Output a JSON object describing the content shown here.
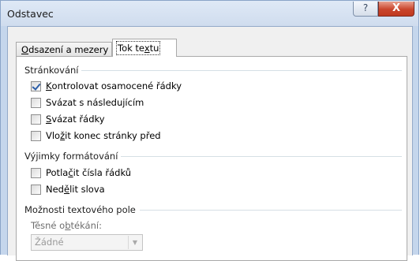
{
  "window": {
    "title": "Odstavec",
    "help_glyph": "?",
    "close_glyph": "X"
  },
  "tabs": [
    {
      "label_pre": "",
      "mnemonic": "O",
      "label_post": "dsazení a mezery",
      "active": false
    },
    {
      "label_pre": "Tok te",
      "mnemonic": "x",
      "label_post": "tu",
      "active": true
    }
  ],
  "pagination": {
    "heading": "Stránkování",
    "options": [
      {
        "pre": "",
        "mnemonic": "K",
        "post": "ontrolovat osamocené řádky",
        "checked": true
      },
      {
        "pre": "Svázat s následujícím",
        "mnemonic": "",
        "post": "",
        "checked": false
      },
      {
        "pre": "",
        "mnemonic": "S",
        "post": "vázat řádky",
        "checked": false
      },
      {
        "pre": "Vlo",
        "mnemonic": "ž",
        "post": "it konec stránky před",
        "checked": false
      }
    ]
  },
  "exceptions": {
    "heading": "Výjimky formátování",
    "options": [
      {
        "pre": "Potla",
        "mnemonic": "č",
        "post": "it čísla řádků",
        "checked": false
      },
      {
        "pre": "Ned",
        "mnemonic": "ě",
        "post": "lit slova",
        "checked": false
      }
    ]
  },
  "textbox": {
    "heading": "Možnosti textového pole",
    "wrap_label_pre": "Těsné o",
    "wrap_label_mnemonic": "b",
    "wrap_label_post": "tékání:",
    "wrap_value": "Žádné",
    "dropdown_glyph": "▼"
  },
  "colors": {
    "check_mark": "#2c5ea8",
    "close_button": "#c9452c",
    "title_bar": "#dfe9f6"
  }
}
